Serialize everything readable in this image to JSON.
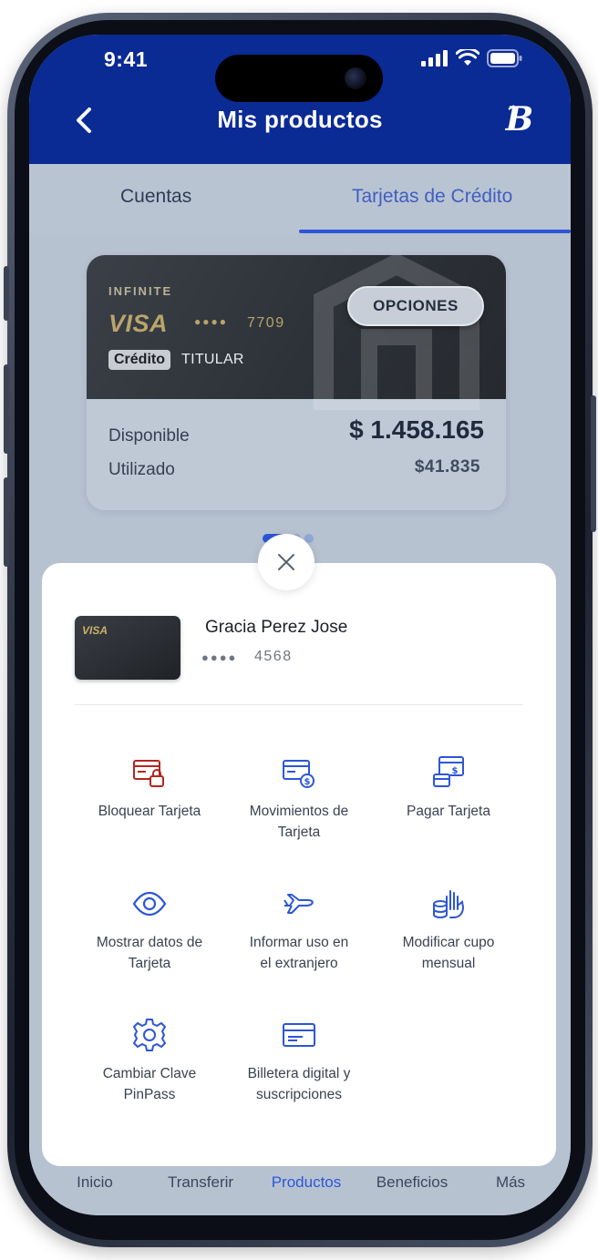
{
  "status_bar": {
    "time": "9:41"
  },
  "header": {
    "title": "Mis productos"
  },
  "tabs": [
    {
      "label": "Cuentas",
      "active": false
    },
    {
      "label": "Tarjetas de Crédito",
      "active": true
    }
  ],
  "card": {
    "tier": "INFINITE",
    "brand": "VISA",
    "masked_dots": "●●●●",
    "last4": "7709",
    "type_badge": "Crédito",
    "holder_type": "TITULAR",
    "options_label": "OPCIONES",
    "available_label": "Disponible",
    "available_value": "$ 1.458.165",
    "used_label": "Utilizado",
    "used_value": "$41.835"
  },
  "pager": {
    "count": 3,
    "active_index": 0
  },
  "sheet": {
    "mini_card_brand": "VISA",
    "holder_name": "Gracia Perez  Jose",
    "masked_dots": "●●●●",
    "last4": "4568",
    "actions": [
      {
        "label_line1": "Bloquear Tarjeta",
        "label_line2": "",
        "icon": "card-lock-icon",
        "color": "#b3261e"
      },
      {
        "label_line1": "Movimientos de",
        "label_line2": "Tarjeta",
        "icon": "card-transactions-icon",
        "color": "#2d56d6"
      },
      {
        "label_line1": "Pagar Tarjeta",
        "label_line2": "",
        "icon": "pay-card-icon",
        "color": "#2d56d6"
      },
      {
        "label_line1": "Mostrar datos de",
        "label_line2": "Tarjeta",
        "icon": "eye-icon",
        "color": "#2d56d6"
      },
      {
        "label_line1": "Informar uso en",
        "label_line2": "el extranjero",
        "icon": "airplane-icon",
        "color": "#2d56d6"
      },
      {
        "label_line1": "Modificar cupo",
        "label_line2": "mensual",
        "icon": "hand-coins-icon",
        "color": "#2d56d6"
      },
      {
        "label_line1": "Cambiar Clave",
        "label_line2": "PinPass",
        "icon": "gear-icon",
        "color": "#2d56d6"
      },
      {
        "label_line1": "Billetera digital y",
        "label_line2": "suscripciones",
        "icon": "wallet-card-icon",
        "color": "#2d56d6"
      }
    ]
  },
  "bottom_nav": [
    {
      "label": "Inicio",
      "active": false
    },
    {
      "label": "Transferir",
      "active": false
    },
    {
      "label": "Productos",
      "active": true
    },
    {
      "label": "Beneficios",
      "active": false
    },
    {
      "label": "Más",
      "active": false
    }
  ],
  "colors": {
    "header_bg": "#0a2a94",
    "accent": "#2d56d6",
    "danger": "#b3261e",
    "overlay_bg": "#b7c2d1"
  }
}
